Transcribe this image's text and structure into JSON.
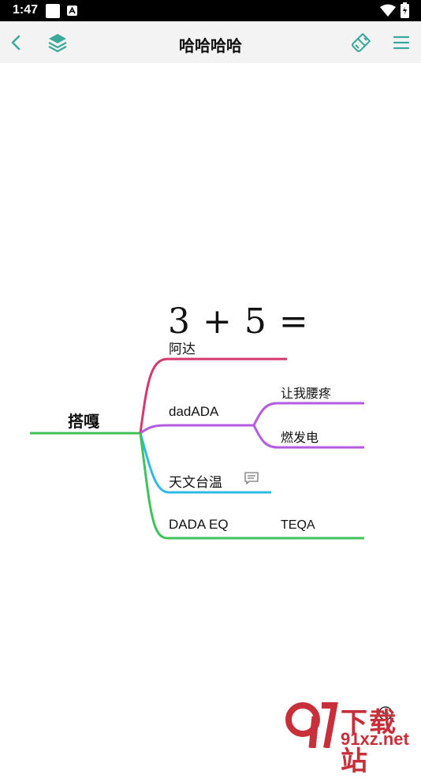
{
  "status_bar": {
    "time": "1:47",
    "icons": [
      "notification-square-icon",
      "app-badge-icon",
      "wifi-icon",
      "battery-icon"
    ]
  },
  "toolbar": {
    "title": "哈哈哈哈",
    "left_icons": [
      "back-chevron-icon",
      "layers-icon"
    ],
    "right_icons": [
      "paint-brush-icon",
      "menu-icon"
    ],
    "accent_color": "#3aa99a"
  },
  "mindmap": {
    "root": {
      "label": "搭嘎",
      "color": "#3fc25a"
    },
    "formula": "3 + 5 =",
    "branches": [
      {
        "label": "阿达",
        "color": "#d23a6e",
        "children": []
      },
      {
        "label": "dadADA",
        "color": "#b45be0",
        "children": [
          "让我腰疼",
          "燃发电"
        ]
      },
      {
        "label": "天文台温",
        "color": "#2fb9e8",
        "children": [],
        "has_comment": true
      },
      {
        "label": "DADA EQ",
        "color": "#3fc25a",
        "children": [
          "TEQA"
        ]
      }
    ]
  },
  "watermark": {
    "line1": "下载站",
    "line2": "91xz.net",
    "color": "#c7303a"
  }
}
